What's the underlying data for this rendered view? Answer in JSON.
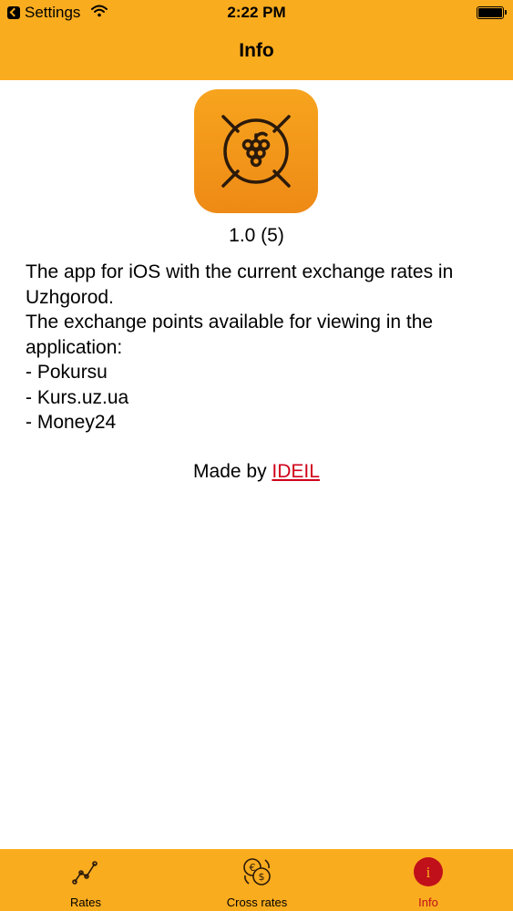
{
  "status_bar": {
    "back_app": "Settings",
    "time": "2:22 PM"
  },
  "nav": {
    "title": "Info"
  },
  "app": {
    "version": "1.0 (5)",
    "description_lines": [
      "The app for iOS with the current exchange rates in Uzhgorod.",
      "The exchange points available for viewing in the application:",
      "- Pokursu",
      "- Kurs.uz.ua",
      "- Money24"
    ],
    "made_by_prefix": "Made by",
    "made_by_link": "IDEIL"
  },
  "tabbar": {
    "tabs": [
      {
        "label": "Rates",
        "icon": "chart-line-icon",
        "active": false
      },
      {
        "label": "Cross rates",
        "icon": "currency-exchange-icon",
        "active": false
      },
      {
        "label": "Info",
        "icon": "info-icon",
        "active": true
      }
    ]
  },
  "colors": {
    "header": "#FAAC1F",
    "accent": "#D0021B",
    "active_tab": "#C0101A"
  }
}
